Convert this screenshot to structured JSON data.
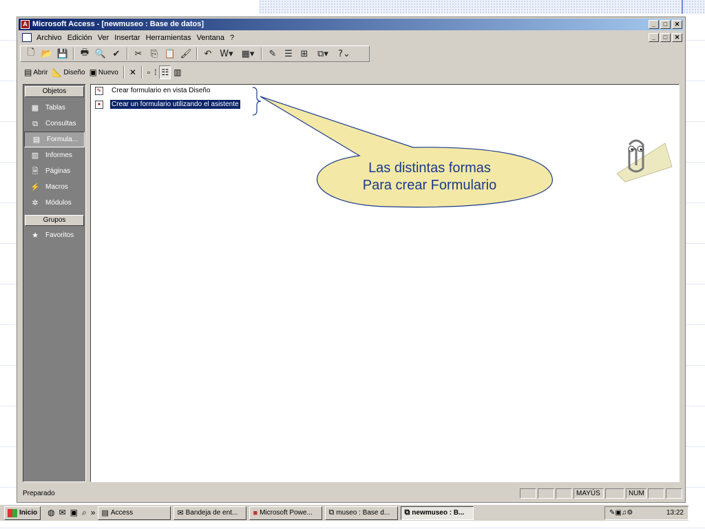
{
  "window": {
    "title": "Microsoft Access - [newmuseo : Base de datos]",
    "caption_buttons": [
      "_",
      "□",
      "✕"
    ]
  },
  "menu": {
    "items": [
      "Archivo",
      "Edición",
      "Ver",
      "Insertar",
      "Herramientas",
      "Ventana",
      "?"
    ]
  },
  "toolbar2": {
    "open_label": "Abrir",
    "design_label": "Diseño",
    "new_label": "Nuevo"
  },
  "objects_bar": {
    "objects_header": "Objetos",
    "items": [
      {
        "label": "Tablas",
        "icon": "table-icon"
      },
      {
        "label": "Consultas",
        "icon": "query-icon"
      },
      {
        "label": "Formula...",
        "icon": "form-icon"
      },
      {
        "label": "Informes",
        "icon": "report-icon"
      },
      {
        "label": "Páginas",
        "icon": "page-icon"
      },
      {
        "label": "Macros",
        "icon": "macro-icon"
      },
      {
        "label": "Módulos",
        "icon": "module-icon"
      }
    ],
    "groups_header": "Grupos",
    "favorites": "Favoritos",
    "active_item": "Formula..."
  },
  "list": {
    "items": [
      {
        "label": "Crear formulario en vista Diseño",
        "selected": false
      },
      {
        "label": "Crear un formulario utilizando el asistente",
        "selected": true
      }
    ]
  },
  "callout": {
    "line1": "Las distintas formas",
    "line2": "Para crear Formulario",
    "fill": "#f3e8a6",
    "text_color": "#1a3a8a"
  },
  "status": {
    "text": "Preparado",
    "caps": "MAYÚS",
    "num": "NUM"
  },
  "taskbar": {
    "start": "Inicio",
    "buttons": [
      {
        "label": "Access",
        "active": false
      },
      {
        "label": "Bandeja de ent...",
        "active": false
      },
      {
        "label": "Microsoft Powe...",
        "active": false
      },
      {
        "label": "museo : Base d...",
        "active": false
      },
      {
        "label": "newmuseo : B...",
        "active": true
      }
    ],
    "clock": "13:22",
    "chevron": "»"
  }
}
